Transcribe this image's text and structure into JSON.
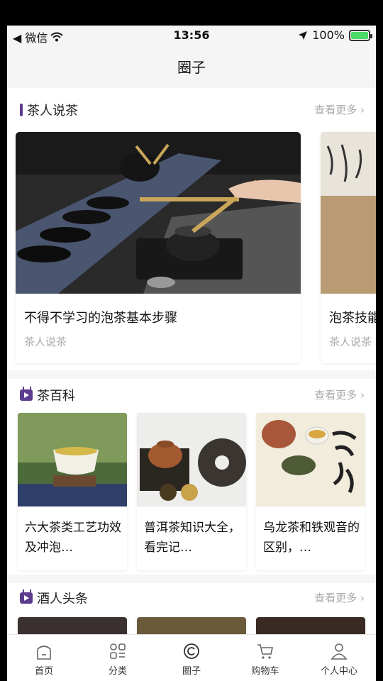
{
  "status_bar": {
    "carrier": "◀ 微信",
    "time": "13:56",
    "battery": "100%",
    "battery_level": 1.0
  },
  "nav": {
    "title": "圈子"
  },
  "sections": [
    {
      "title": "茶人说茶",
      "more": "查看更多 ›",
      "cards": [
        {
          "title": "不得不学习的泡茶基本步骤",
          "source": "茶人说茶"
        },
        {
          "title": "泡茶技能",
          "source": "茶人说茶"
        }
      ]
    },
    {
      "title": "茶百科",
      "more": "查看更多 ›",
      "cards": [
        {
          "title": "六大茶类工艺功效及冲泡…"
        },
        {
          "title": "普洱茶知识大全，看完记…"
        },
        {
          "title": "乌龙茶和铁观音的区别，…"
        }
      ]
    },
    {
      "title": "酒人头条",
      "more": "查看更多 ›"
    }
  ],
  "tabs": [
    {
      "label": "首页",
      "icon": "home-icon"
    },
    {
      "label": "分类",
      "icon": "category-icon"
    },
    {
      "label": "圈子",
      "icon": "circle-icon"
    },
    {
      "label": "购物车",
      "icon": "cart-icon"
    },
    {
      "label": "个人中心",
      "icon": "profile-icon"
    }
  ],
  "colors": {
    "accent": "#5b3c8e",
    "more": "#aaaaaa",
    "battery": "#4cd964"
  }
}
